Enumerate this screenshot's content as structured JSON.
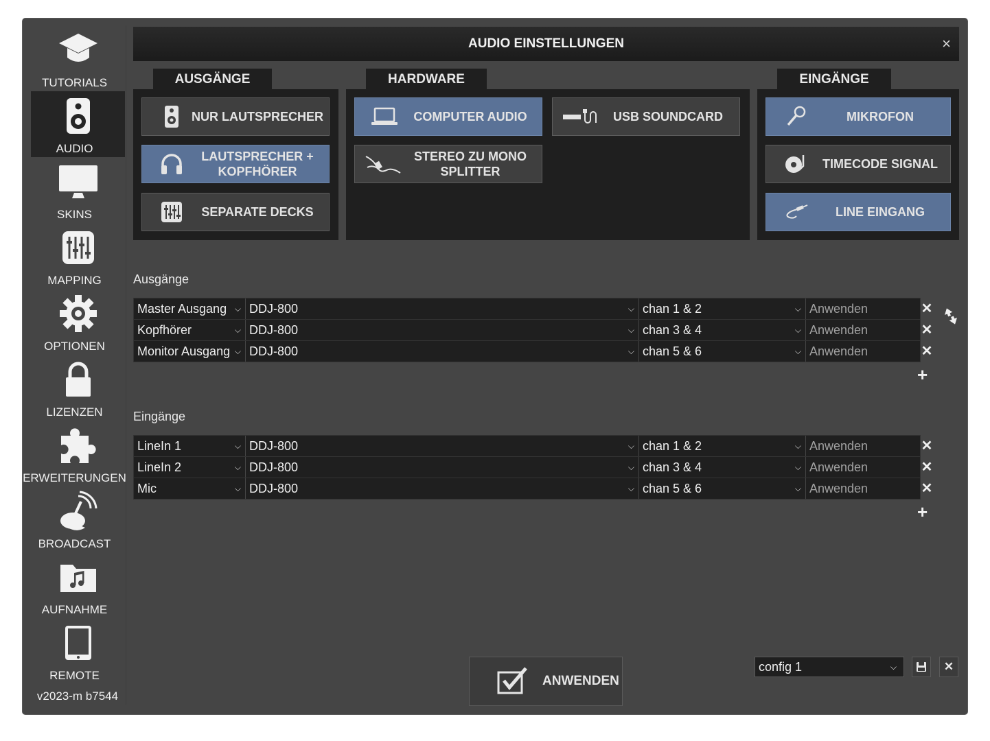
{
  "sidebar": {
    "items": [
      {
        "label": "TUTORIALS",
        "icon": "graduation-cap-icon"
      },
      {
        "label": "AUDIO",
        "icon": "speaker-icon"
      },
      {
        "label": "SKINS",
        "icon": "monitor-icon"
      },
      {
        "label": "MAPPING",
        "icon": "sliders-icon"
      },
      {
        "label": "OPTIONEN",
        "icon": "gear-icon"
      },
      {
        "label": "LIZENZEN",
        "icon": "lock-icon"
      },
      {
        "label": "ERWEITERUNGEN",
        "icon": "puzzle-icon"
      },
      {
        "label": "BROADCAST",
        "icon": "satellite-dish-icon"
      },
      {
        "label": "AUFNAHME",
        "icon": "music-folder-icon"
      },
      {
        "label": "REMOTE",
        "icon": "tablet-icon"
      }
    ],
    "version": "v2023-m b7544"
  },
  "dialog": {
    "title": "AUDIO EINSTELLUNGEN",
    "close": "×"
  },
  "panels": {
    "ausgaenge": {
      "tab": "AUSGÄNGE",
      "buttons": [
        {
          "label": "NUR LAUTSPRECHER",
          "icon": "speaker-icon",
          "selected": false
        },
        {
          "label": "LAUTSPRECHER + KOPFHÖRER",
          "icon": "headphones-icon",
          "selected": true
        },
        {
          "label": "SEPARATE DECKS",
          "icon": "mixer-icon",
          "selected": false
        }
      ]
    },
    "hardware": {
      "tab": "HARDWARE",
      "buttons": [
        {
          "label": "COMPUTER AUDIO",
          "icon": "laptop-icon",
          "selected": true
        },
        {
          "label": "USB SOUNDCARD",
          "icon": "usb-soundcard-icon",
          "selected": false
        },
        {
          "label": "STEREO ZU MONO SPLITTER",
          "icon": "splitter-cable-icon",
          "selected": false
        }
      ]
    },
    "eingaenge": {
      "tab": "EINGÄNGE",
      "buttons": [
        {
          "label": "MIKROFON",
          "icon": "microphone-icon",
          "selected": true
        },
        {
          "label": "TIMECODE SIGNAL",
          "icon": "vinyl-icon",
          "selected": false
        },
        {
          "label": "LINE EINGANG",
          "icon": "line-cable-icon",
          "selected": true
        }
      ]
    }
  },
  "outputs": {
    "label": "Ausgänge",
    "rows": [
      {
        "name": "Master Ausgang",
        "device": "DDJ-800",
        "channel": "chan 1 & 2",
        "apply": "Anwenden"
      },
      {
        "name": "Kopfhörer",
        "device": "DDJ-800",
        "channel": "chan 3 & 4",
        "apply": "Anwenden"
      },
      {
        "name": "Monitor Ausgang",
        "device": "DDJ-800",
        "channel": "chan 5 & 6",
        "apply": "Anwenden"
      }
    ]
  },
  "inputs": {
    "label": "Eingänge",
    "rows": [
      {
        "name": "LineIn 1",
        "device": "DDJ-800",
        "channel": "chan 1 & 2",
        "apply": "Anwenden"
      },
      {
        "name": "LineIn 2",
        "device": "DDJ-800",
        "channel": "chan 3 & 4",
        "apply": "Anwenden"
      },
      {
        "name": "Mic",
        "device": "DDJ-800",
        "channel": "chan 5 & 6",
        "apply": "Anwenden"
      }
    ]
  },
  "footer": {
    "apply_label": "ANWENDEN",
    "config_value": "config 1"
  },
  "colors": {
    "selected_button": "#5a7297",
    "panel_bg": "#1f1f1f",
    "window_bg": "#454545"
  }
}
